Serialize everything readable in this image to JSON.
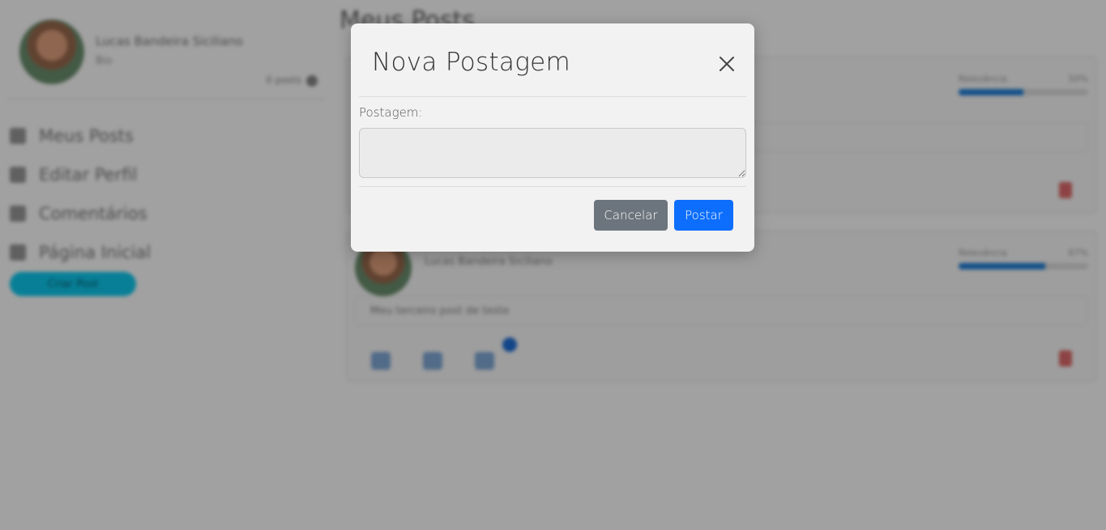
{
  "background": {
    "sidebar": {
      "profile_name": "Lucas Bandeira Siciliano",
      "profile_sub": "Bio",
      "profile_count": "0 posts",
      "nav_items": [
        {
          "label": "Meus Posts",
          "icon": "file-icon"
        },
        {
          "label": "Editar Perfil",
          "icon": "user-icon"
        },
        {
          "label": "Comentários",
          "icon": "comment-icon"
        },
        {
          "label": "Página Inicial",
          "icon": "home-icon"
        }
      ],
      "create_button": "Criar Post"
    },
    "main": {
      "title": "Meus Posts",
      "posts": [
        {
          "author": "",
          "progress_label": "Relevância",
          "progress_value": "50%",
          "progress_fraction": 0.5,
          "text": ""
        },
        {
          "author": "Lucas Bandeira Siciliano",
          "progress_label": "Relevância",
          "progress_value": "67%",
          "progress_fraction": 0.67,
          "text": "Meu terceiro post de teste"
        }
      ]
    }
  },
  "modal": {
    "title": "Nova Postagem",
    "close_icon": "close-icon",
    "field_label": "Postagem:",
    "textarea_value": "",
    "textarea_placeholder": "",
    "cancel_label": "Cancelar",
    "post_label": "Postar",
    "colors": {
      "cancel": "#6c757d",
      "primary": "#0d6efd"
    }
  }
}
